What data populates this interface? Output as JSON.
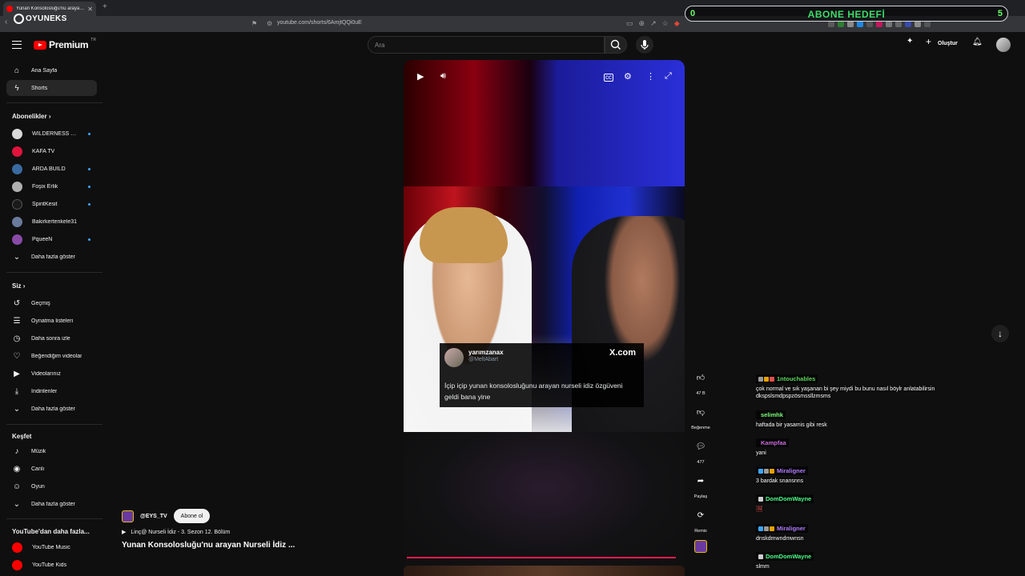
{
  "browser": {
    "tab_title": "Yunan Konsolosluğu'nu arayan N",
    "url": "youtube.com/shorts/6AmjtQQi0uE",
    "overlay_logo": "OYUNEKS"
  },
  "goal_overlay": {
    "current": "0",
    "label": "ABONE HEDEFİ",
    "target": "5"
  },
  "header": {
    "brand": "Premium",
    "region": "TR",
    "search_placeholder": "Ara",
    "create_label": "Oluştur"
  },
  "sidebar": {
    "main": [
      {
        "label": "Ana Sayfa",
        "icon": "home-icon",
        "glyph": "⌂"
      },
      {
        "label": "Shorts",
        "icon": "shorts-icon",
        "glyph": "ϟ",
        "active": true
      }
    ],
    "subs_title": "Abonelikler",
    "subs": [
      {
        "label": "WILDERNESS CO...",
        "color": "#d9d9d9",
        "dot": true
      },
      {
        "label": "KAFA TV",
        "color": "#e0143c",
        "dot": false
      },
      {
        "label": "ARDA BUILD",
        "color": "#3a6aa0",
        "dot": true
      },
      {
        "label": "Foşix Erlik",
        "color": "#b0b0b0",
        "dot": true
      },
      {
        "label": "SpiritKesit",
        "color": "#1a1a1a",
        "dot": true
      },
      {
        "label": "Bakirkertenkele31",
        "color": "#6a7a9a",
        "dot": false
      },
      {
        "label": "PqueeN",
        "color": "#8a4aa8",
        "dot": true
      }
    ],
    "subs_more": "Daha fazla göster",
    "you_title": "Siz",
    "you": [
      {
        "label": "Geçmiş",
        "icon": "history-icon",
        "glyph": "↺"
      },
      {
        "label": "Oynatma listeleri",
        "icon": "playlists-icon",
        "glyph": "☰"
      },
      {
        "label": "Daha sonra izle",
        "icon": "watch-later-icon",
        "glyph": "◷"
      },
      {
        "label": "Beğendiğim videolar",
        "icon": "liked-icon",
        "glyph": "👍"
      },
      {
        "label": "Videolarınız",
        "icon": "your-videos-icon",
        "glyph": "▶"
      },
      {
        "label": "İndirilenler",
        "icon": "download-icon",
        "glyph": "⤓"
      }
    ],
    "you_more": "Daha fazla göster",
    "explore_title": "Keşfet",
    "explore": [
      {
        "label": "Müzik",
        "icon": "music-icon",
        "glyph": "♪"
      },
      {
        "label": "Canlı",
        "icon": "live-icon",
        "glyph": "◉"
      },
      {
        "label": "Oyun",
        "icon": "gaming-icon",
        "glyph": "🎮"
      }
    ],
    "explore_more": "Daha fazla göster",
    "more_title": "YouTube'dan daha fazla...",
    "more": [
      {
        "label": "YouTube Music",
        "color": "#ff0000"
      },
      {
        "label": "YouTube Kids",
        "color": "#ff0000"
      }
    ]
  },
  "short": {
    "tweet_name": "yarımzanax",
    "tweet_handle": "@MeltAbart",
    "tweet_source": "X.com",
    "tweet_text": "İçip içip yunan konsolosluğunu arayan nurseli idiz özgüveni geldi bana yine",
    "channel": "@EYS_TV",
    "subscribe_label": "Abone ol",
    "playlist": "Linç@ Nurseli İdiz - 3. Sezon 12. Bölüm",
    "title": "Yunan Konsolosluğu'nu arayan Nurseli İdiz ...",
    "progress": 0.98
  },
  "actions": {
    "likes": "47 B",
    "dislike_label": "Beğenme",
    "comments": "477",
    "share_label": "Paylaş",
    "remix_label": "Remix"
  },
  "chat": [
    {
      "user": "1ntouchables",
      "color": "#5cd65c",
      "badges": [
        "#9a9a9a",
        "#e6a200",
        "#e05050"
      ],
      "text": "çok normal ve sık yaşanan bi şey miydi bu bunu nasıl böylr anlatabilirsin dkspslsmdpspzösmssllzmsms"
    },
    {
      "user": "selimhk",
      "color": "#7cff7c",
      "badges": [],
      "text": "haftada bir yasamis gibi resk"
    },
    {
      "user": "Kampfaa",
      "color": "#c86ad8",
      "badges": [],
      "text": "yani"
    },
    {
      "user": "Miraligner",
      "color": "#b07aff",
      "badges": [
        "#3ea6ff",
        "#9a9a9a",
        "#e6a200"
      ],
      "text": "3 bardak snansnns"
    },
    {
      "user": "DomDomWayne",
      "color": "#4cff8a",
      "badges": [
        "#cfcfcf"
      ],
      "text": ""
    },
    {
      "user": "Miraligner",
      "color": "#b07aff",
      "badges": [
        "#3ea6ff",
        "#9a9a9a",
        "#e6a200"
      ],
      "text": "dnskdmwndmwnsn"
    },
    {
      "user": "DomDomWayne",
      "color": "#4cff8a",
      "badges": [
        "#cfcfcf"
      ],
      "text": "slmm"
    }
  ]
}
